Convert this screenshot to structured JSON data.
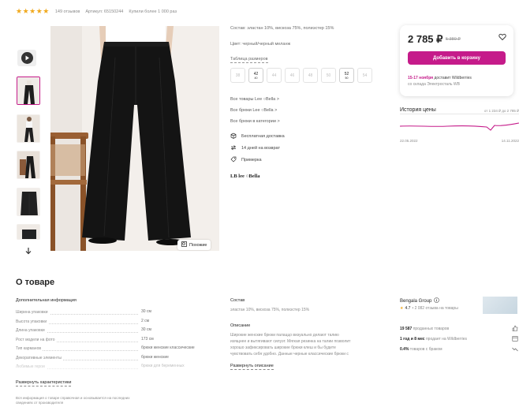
{
  "header": {
    "stars": "★★★★★",
    "reviews": "149 отзывов",
    "article": "Артикул: 65150244",
    "bought": "Купили более 1 000 раз"
  },
  "gallery": {
    "similar_label": "Похожие"
  },
  "details": {
    "composition": "Состав: эластан 10%, вискоза 75%, полиэстер 15%",
    "color": "Цвет: черный/черный меланж",
    "size_table": "Таблица размеров",
    "sizes": [
      {
        "ru": "38",
        "eu": "",
        "available": false
      },
      {
        "ru": "42",
        "eu": "40",
        "available": true
      },
      {
        "ru": "44",
        "eu": "",
        "available": false
      },
      {
        "ru": "46",
        "eu": "",
        "available": false
      },
      {
        "ru": "48",
        "eu": "",
        "available": false
      },
      {
        "ru": "50",
        "eu": "",
        "available": false
      },
      {
        "ru": "52",
        "eu": "50",
        "available": true
      },
      {
        "ru": "54",
        "eu": "",
        "available": false
      }
    ],
    "links": [
      "Все товары Lee ○Bella >",
      "Все брюки Lee ○Bella >",
      "Все брюки в категории >"
    ],
    "features": [
      "Бесплатная доставка",
      "14 дней на возврат",
      "Примерка"
    ],
    "brand_logo": "LB lee ○Bella"
  },
  "price_card": {
    "price": "2 785 ₽",
    "old_price": "5 380 ₽",
    "cart_button": "Добавить в корзину",
    "delivery_date": "15-17 ноября",
    "delivery_text": "доставит Wildberries",
    "warehouse": "со склада Электросталь WB"
  },
  "price_history": {
    "title": "История цены",
    "range": "от 1 234 ₽ до 2 785 ₽",
    "date_start": "22.05.2022",
    "date_end": "14.11.2022"
  },
  "about": {
    "title": "О товаре",
    "additional_title": "Дополнительная информация",
    "specs": [
      {
        "label": "Ширина упаковки",
        "value": "30 см"
      },
      {
        "label": "Высота упаковки",
        "value": "2 см"
      },
      {
        "label": "Длина упаковки",
        "value": "30 см"
      },
      {
        "label": "Рост модели на фото",
        "value": "173 см"
      },
      {
        "label": "Тип карманов",
        "value": "брюки женские классические"
      },
      {
        "label": "Декоративные элементы",
        "value": "брюки женские"
      },
      {
        "label": "Любимые герои",
        "value": "брюки для беременных"
      }
    ],
    "expand_specs": "Развернуть характеристики",
    "disclaimer_1": "Вся информация о товаре справочная и основывается на последних",
    "disclaimer_2": "сведениях от производителя",
    "composition_title": "Состав",
    "composition_value": "эластан 10%, вискоза 75%, полиэстер 15%",
    "description_title": "Описание",
    "description_lines": [
      "Широкие женские брюки палаццо визуально делают талию",
      "изящнее и вытягивают силуэт. Мягкая резинка на талии позволит",
      "хорошо зафиксировать широкие брюки клеш и бы будете",
      "чувствовать себя удобно. Данные черные классические брюки с"
    ],
    "expand_description": "Развернуть описание"
  },
  "seller": {
    "name": "Bengala Group",
    "rating": "4.7",
    "rating_text": "• 2 082 отзыва на товары",
    "stats": [
      {
        "bold": "19 587",
        "text": "проданных товаров"
      },
      {
        "bold": "1 год и 8 мес",
        "text": "продает на Wildberries"
      },
      {
        "bold": "0.4%",
        "text": "товаров с браком"
      }
    ]
  }
}
